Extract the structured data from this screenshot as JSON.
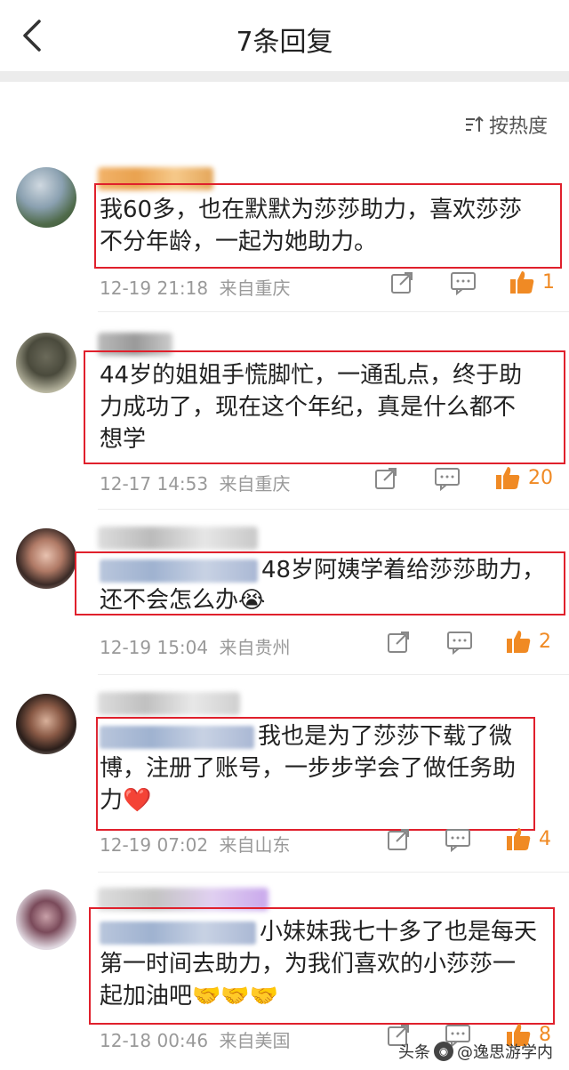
{
  "header": {
    "title": "7条回复"
  },
  "sort": {
    "label": "按热度"
  },
  "comments": [
    {
      "text": "我60多，也在默默为莎莎助力，喜欢莎莎不分年龄，一起为她助力。",
      "line1": "我60多，也在默默为莎莎助力，喜欢莎莎",
      "line2": "不分年龄，一起为她助力。",
      "line3": "",
      "time": "12-19 21:18",
      "location": "来自重庆",
      "likes": "1"
    },
    {
      "text": "44岁的姐姐手慌脚忙，一通乱点，终于助力成功了，现在这个年纪，真是什么都不想学",
      "line1": "44岁的姐姐手慌脚忙，一通乱点，终于助",
      "line2": "力成功了，现在这个年纪，真是什么都不",
      "line3": "想学",
      "time": "12-17 14:53",
      "location": "来自重庆",
      "likes": "20"
    },
    {
      "text": "48岁阿姨学着给莎莎助力，还不会怎么办😭",
      "line1": "48岁阿姨学着给莎莎助力，",
      "line2": "还不会怎么办😭",
      "line3": "",
      "time": "12-19 15:04",
      "location": "来自贵州",
      "likes": "2"
    },
    {
      "text": "我也是为了莎莎下载了微博，注册了账号，一步步学会了做任务助力❤️",
      "line1": "我也是为了莎莎下载了微",
      "line2": "博，注册了账号，一步步学会了做任务助",
      "line3": "力❤️",
      "time": "12-19 07:02",
      "location": "来自山东",
      "likes": "4"
    },
    {
      "text": "小妹妹我七十多了也是每天第一时间去助力，为我们喜欢的小莎莎一起加油吧🤝🤝🤝",
      "line1": "小妹妹我七十多了也是每天",
      "line2": "第一时间去助力，为我们喜欢的小莎莎一",
      "line3": "起加油吧🤝🤝🤝",
      "time": "12-18 00:46",
      "location": "来自美国",
      "likes": "8"
    }
  ],
  "watermark": {
    "prefix": "头条",
    "handle": "@逸思游学内"
  },
  "colors": {
    "accent_red": "#e0202c",
    "like_orange": "#f08a24",
    "meta_gray": "#999999"
  }
}
